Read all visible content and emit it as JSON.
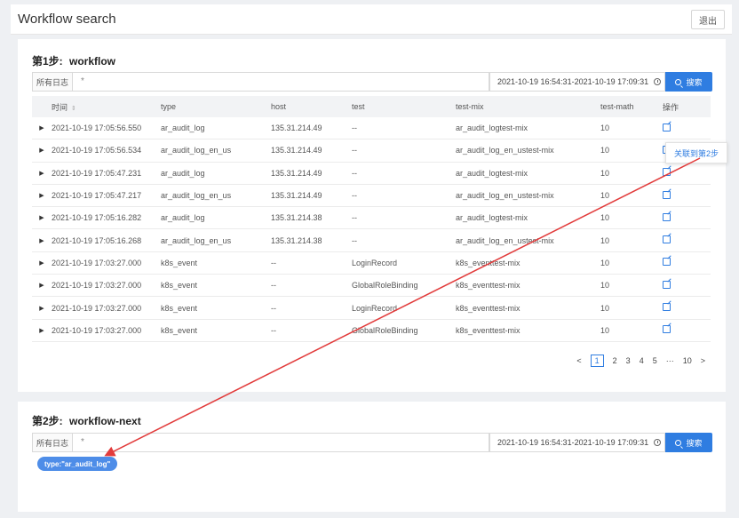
{
  "app": {
    "title": "Workflow search",
    "logout_label": "退出"
  },
  "step1": {
    "prefix": "第1步:",
    "name": "workflow",
    "log_label": "所有日志",
    "query_value": "*",
    "time_range": "2021-10-19 16:54:31-2021-10-19 17:09:31",
    "search_label": "搜索"
  },
  "table": {
    "headers": [
      "时间",
      "type",
      "host",
      "test",
      "test-mix",
      "test-math",
      "操作"
    ],
    "rows": [
      [
        "2021-10-19 17:05:56.550",
        "ar_audit_log",
        "135.31.214.49",
        "--",
        "ar_audit_logtest-mix",
        "10"
      ],
      [
        "2021-10-19 17:05:56.534",
        "ar_audit_log_en_us",
        "135.31.214.49",
        "--",
        "ar_audit_log_en_ustest-mix",
        "10"
      ],
      [
        "2021-10-19 17:05:47.231",
        "ar_audit_log",
        "135.31.214.49",
        "--",
        "ar_audit_logtest-mix",
        "10"
      ],
      [
        "2021-10-19 17:05:47.217",
        "ar_audit_log_en_us",
        "135.31.214.49",
        "--",
        "ar_audit_log_en_ustest-mix",
        "10"
      ],
      [
        "2021-10-19 17:05:16.282",
        "ar_audit_log",
        "135.31.214.38",
        "--",
        "ar_audit_logtest-mix",
        "10"
      ],
      [
        "2021-10-19 17:05:16.268",
        "ar_audit_log_en_us",
        "135.31.214.38",
        "--",
        "ar_audit_log_en_ustest-mix",
        "10"
      ],
      [
        "2021-10-19 17:03:27.000",
        "k8s_event",
        "--",
        "LoginRecord",
        "k8s_eventtest-mix",
        "10"
      ],
      [
        "2021-10-19 17:03:27.000",
        "k8s_event",
        "--",
        "GlobalRoleBinding",
        "k8s_eventtest-mix",
        "10"
      ],
      [
        "2021-10-19 17:03:27.000",
        "k8s_event",
        "--",
        "LoginRecord",
        "k8s_eventtest-mix",
        "10"
      ],
      [
        "2021-10-19 17:03:27.000",
        "k8s_event",
        "--",
        "GlobalRoleBinding",
        "k8s_eventtest-mix",
        "10"
      ]
    ]
  },
  "pagination": {
    "prev": "<",
    "pages": [
      "1",
      "2",
      "3",
      "4",
      "5"
    ],
    "ellipsis": "···",
    "last": "10",
    "next": ">",
    "current": "1"
  },
  "tooltip": {
    "label": "关联到第2步"
  },
  "step2": {
    "prefix": "第2步:",
    "name": "workflow-next",
    "log_label": "所有日志",
    "query_value": "*",
    "time_range": "2021-10-19 16:54:31-2021-10-19 17:09:31",
    "search_label": "搜索",
    "filter_chip": "type:\"ar_audit_log\""
  },
  "colors": {
    "accent": "#2f7de1",
    "arrow": "#e23c3c",
    "chip": "#4e8de8"
  }
}
